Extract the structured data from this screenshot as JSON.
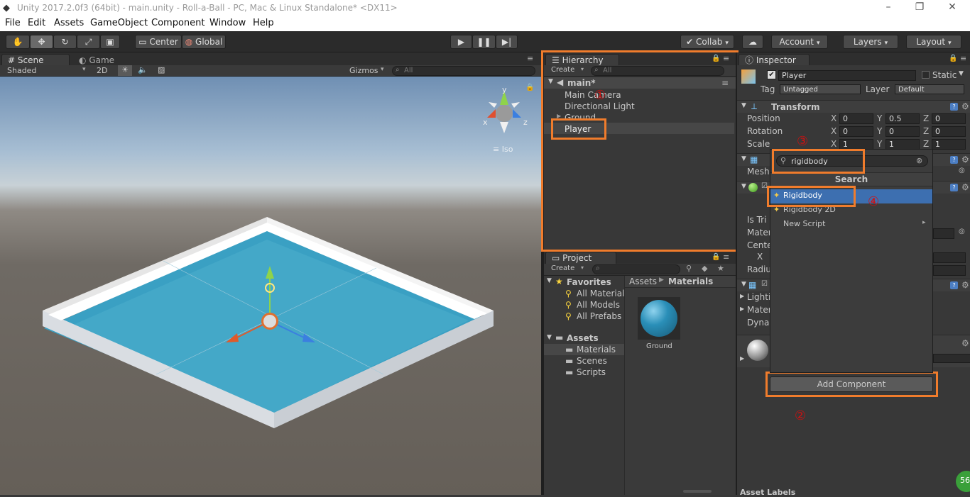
{
  "window": {
    "title": "Unity 2017.2.0f3 (64bit) - main.unity - Roll-a-Ball - PC, Mac & Linux Standalone* <DX11>"
  },
  "menu": [
    "File",
    "Edit",
    "Assets",
    "GameObject",
    "Component",
    "Window",
    "Help"
  ],
  "toolbar": {
    "center": "Center",
    "global": "Global",
    "collab": "Collab",
    "account": "Account",
    "layers": "Layers",
    "layout": "Layout"
  },
  "scene": {
    "tab_scene": "Scene",
    "tab_game": "Game",
    "shading": "Shaded",
    "mode_2d": "2D",
    "gizmos": "Gizmos",
    "search_placeholder": "All",
    "iso_label": "Iso",
    "axis_x": "x",
    "axis_y": "y",
    "axis_z": "z"
  },
  "hierarchy": {
    "tab": "Hierarchy",
    "create": "Create",
    "search_placeholder": "All",
    "scene_name": "main*",
    "items": [
      "Main Camera",
      "Directional Light",
      "Ground",
      "Player"
    ]
  },
  "project": {
    "tab": "Project",
    "create": "Create",
    "favorites_label": "Favorites",
    "favorites": [
      "All Materials",
      "All Models",
      "All Prefabs"
    ],
    "assets_label": "Assets",
    "folders": [
      "Materials",
      "Scenes",
      "Scripts"
    ],
    "breadcrumb_root": "Assets",
    "breadcrumb_current": "Materials",
    "asset_items": [
      "Ground"
    ]
  },
  "inspector": {
    "tab": "Inspector",
    "object_name": "Player",
    "static_label": "Static",
    "tag_label": "Tag",
    "tag_value": "Untagged",
    "layer_label": "Layer",
    "layer_value": "Default",
    "transform": {
      "title": "Transform",
      "position_label": "Position",
      "rotation_label": "Rotation",
      "scale_label": "Scale",
      "position": {
        "x": "0",
        "y": "0.5",
        "z": "0"
      },
      "rotation": {
        "x": "0",
        "y": "0",
        "z": "0"
      },
      "scale": {
        "x": "1",
        "y": "1",
        "z": "1"
      }
    },
    "partial_labels": [
      "Mesh",
      "Is Tri",
      "Mater",
      "Cente",
      "X",
      "Radiu",
      "Lightin",
      "Mater",
      "Dynar"
    ],
    "add_component": "Add Component",
    "asset_labels": "Asset Labels"
  },
  "popup": {
    "search_value": "rigidbody",
    "header": "Search",
    "items": [
      "Rigidbody",
      "Rigidbody 2D",
      "New Script"
    ]
  },
  "annotations": [
    "①",
    "②",
    "③",
    "④"
  ],
  "colors": {
    "highlight_orange": "#f07c2c",
    "annotation_red": "#d01010",
    "selection_blue": "#3d6fb0",
    "ground_blue": "#3aa0c3"
  }
}
